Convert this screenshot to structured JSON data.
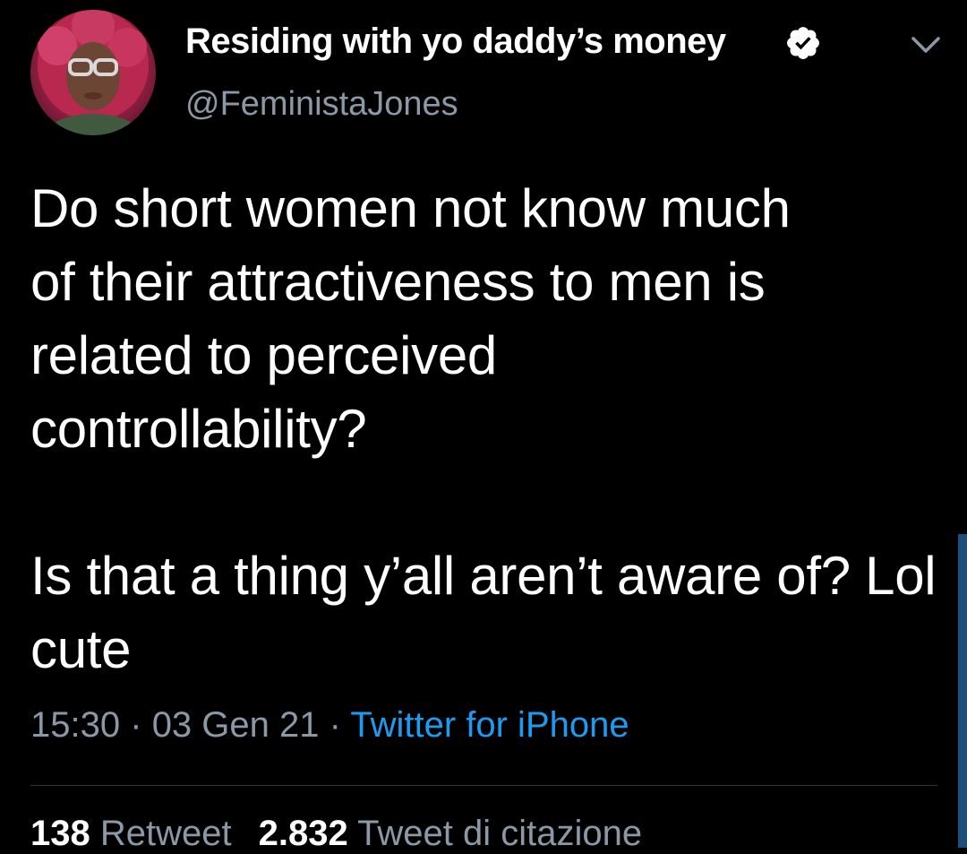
{
  "author": {
    "display_name": "Residing with yo daddy’s money",
    "handle": "@FeministaJones",
    "verified": true,
    "avatar_icon": "profile-photo"
  },
  "tweet": {
    "paragraphs": [
      "Do short women not know much of their attractiveness to men is related to perceived controllability?",
      "Is that a thing y’all aren’t aware of? Lol cute"
    ],
    "time": "15:30",
    "date": "03 Gen 21",
    "separator": "·",
    "source": "Twitter for iPhone"
  },
  "stats": {
    "retweets_count": "138",
    "retweets_label": "Retweet",
    "quotes_count": "2.832",
    "quotes_label": "Tweet di citazione"
  },
  "colors": {
    "background": "#000000",
    "text": "#ffffff",
    "secondary_text": "#8b98a5",
    "link": "#1d9bf0",
    "divider": "#2f3336"
  }
}
